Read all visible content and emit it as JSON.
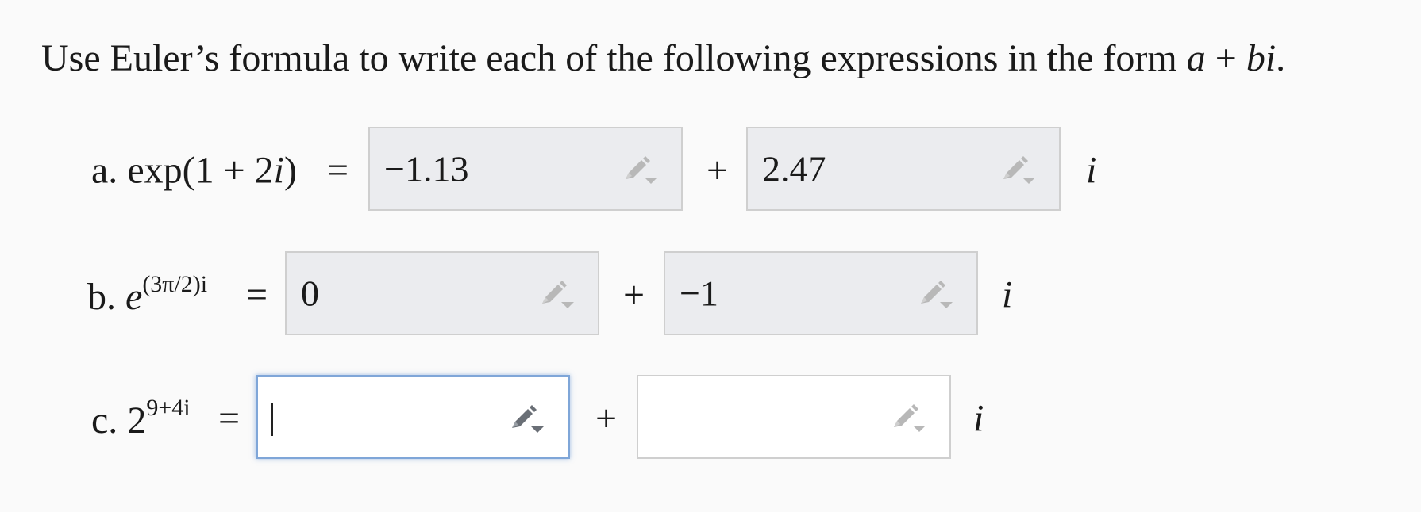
{
  "prompt": {
    "text": "Use Euler’s formula to write each of the following expressions in the form ",
    "math_a": "a",
    "math_plus": " + ",
    "math_b": "b",
    "math_i": "i",
    "period": "."
  },
  "problems": [
    {
      "letter": "a.",
      "expr_prefix": "exp(1 + 2",
      "expr_i": "i",
      "expr_suffix": ")",
      "equals": "=",
      "real_value": "−1.13",
      "plus": "+",
      "imag_value": "2.47",
      "imag_unit": "i",
      "state": "answered"
    },
    {
      "letter": "b.",
      "base": "e",
      "exponent": "(3π/2)i",
      "equals": "=",
      "real_value": "0",
      "plus": "+",
      "imag_value": "−1",
      "imag_unit": "i",
      "state": "answered"
    },
    {
      "letter": "c.",
      "base": "2",
      "exponent": "9+4i",
      "equals": "=",
      "real_value": "",
      "plus": "+",
      "imag_value": "",
      "imag_unit": "i",
      "state": "editing"
    }
  ],
  "icons": {
    "answer_box_icon": "pencil-dropdown-icon"
  },
  "colors": {
    "answered_box_bg": "#ebecef",
    "empty_box_bg": "#ffffff",
    "focus_border": "#7fa6d8",
    "pencil_inactive": "#b8b8b8",
    "pencil_active": "#6a6f76"
  }
}
